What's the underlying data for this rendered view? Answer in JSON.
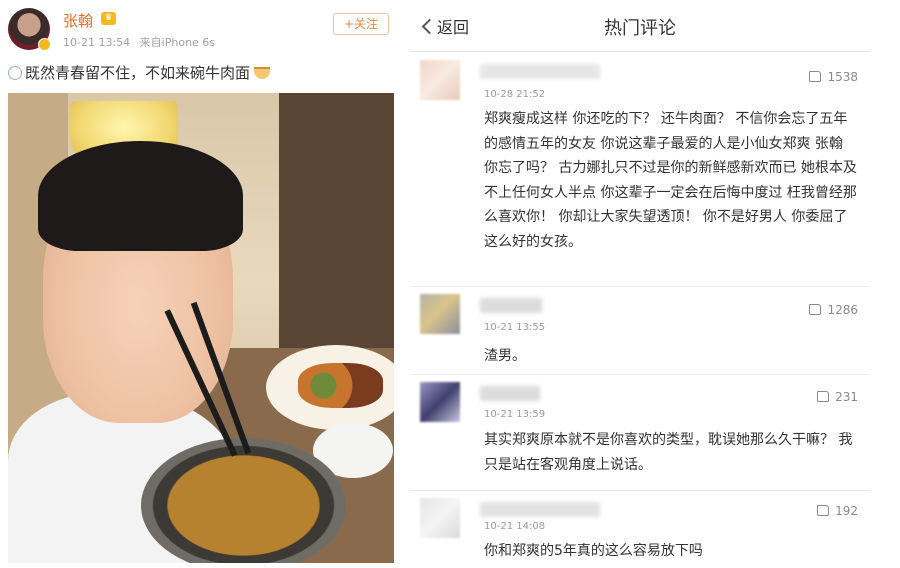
{
  "post": {
    "poster_name": "张翰",
    "timestamp": "10-21 13:54",
    "device": "来自iPhone 6s",
    "follow_label": "+关注",
    "text": "既然青春留不住，不如来碗牛肉面"
  },
  "comments_page": {
    "back_label": "返回",
    "title": "热门评论",
    "comments": [
      {
        "time": "10-28 21:52",
        "likes": "1538",
        "text": "郑爽瘦成这样 你还吃的下？ 还牛肉面？ 不信你会忘了五年的感情五年的女友 你说这辈子最爱的人是小仙女郑爽 张翰 你忘了吗？ 古力娜扎只不过是你的新鲜感新欢而已 她根本及不上任何女人半点 你这辈子一定会在后悔中度过 枉我曾经那么喜欢你！ 你却让大家失望透顶！ 你不是好男人 你委屈了这么好的女孩。"
      },
      {
        "time": "10-21 13:55",
        "likes": "1286",
        "text": "渣男。"
      },
      {
        "time": "10-21 13:59",
        "likes": "231",
        "text": "其实郑爽原本就不是你喜欢的类型，耽误她那么久干嘛？ 我只是站在客观角度上说话。"
      },
      {
        "time": "10-21 14:08",
        "likes": "192",
        "text": "你和郑爽的5年真的这么容易放下吗"
      }
    ]
  },
  "colors": {
    "name_orange": "#e86c1e",
    "meta_gray": "#a0a0a0",
    "follow_border": "#f2c19a"
  },
  "icons": [
    "vip-badge-icon",
    "crown-icon",
    "emoji-icon",
    "bowl-emoji-icon",
    "back-chevron-icon",
    "thumbs-up-icon"
  ]
}
